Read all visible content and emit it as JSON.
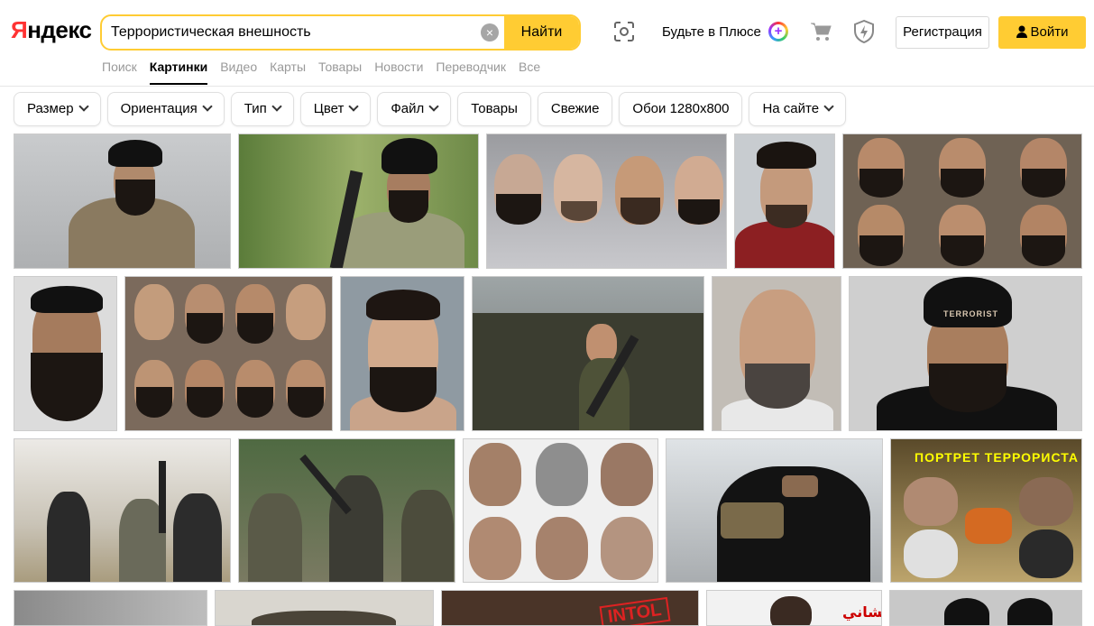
{
  "header": {
    "logo_first": "Я",
    "logo_rest": "ндекс",
    "search": {
      "value": "Террористическая внешность",
      "clear_icon": "×",
      "find_label": "Найти"
    },
    "plus_text": "Будьте в Плюсе",
    "plus_badge": "+",
    "register_label": "Регистрация",
    "login_label": "Войти"
  },
  "tabs": [
    "Поиск",
    "Картинки",
    "Видео",
    "Карты",
    "Товары",
    "Новости",
    "Переводчик",
    "Все"
  ],
  "active_tab": "Картинки",
  "filters": [
    {
      "label": "Размер",
      "dropdown": true
    },
    {
      "label": "Ориентация",
      "dropdown": true
    },
    {
      "label": "Тип",
      "dropdown": true
    },
    {
      "label": "Цвет",
      "dropdown": true
    },
    {
      "label": "Файл",
      "dropdown": true
    },
    {
      "label": "Товары",
      "dropdown": false
    },
    {
      "label": "Свежие",
      "dropdown": false
    },
    {
      "label": "Обои 1280x800",
      "dropdown": false
    },
    {
      "label": "На сайте",
      "dropdown": true
    }
  ],
  "image_text": {
    "portrait_title": "ПОРТРЕТ   ТЕРРОРИСТА",
    "forehead_word": "TERRORIST",
    "stamp_word": "INTOL",
    "arabic_caption": "يشاني"
  },
  "colors": {
    "accent_yellow": "#ffcc33",
    "logo_red": "#ff3333",
    "tab_inactive": "#999999"
  }
}
